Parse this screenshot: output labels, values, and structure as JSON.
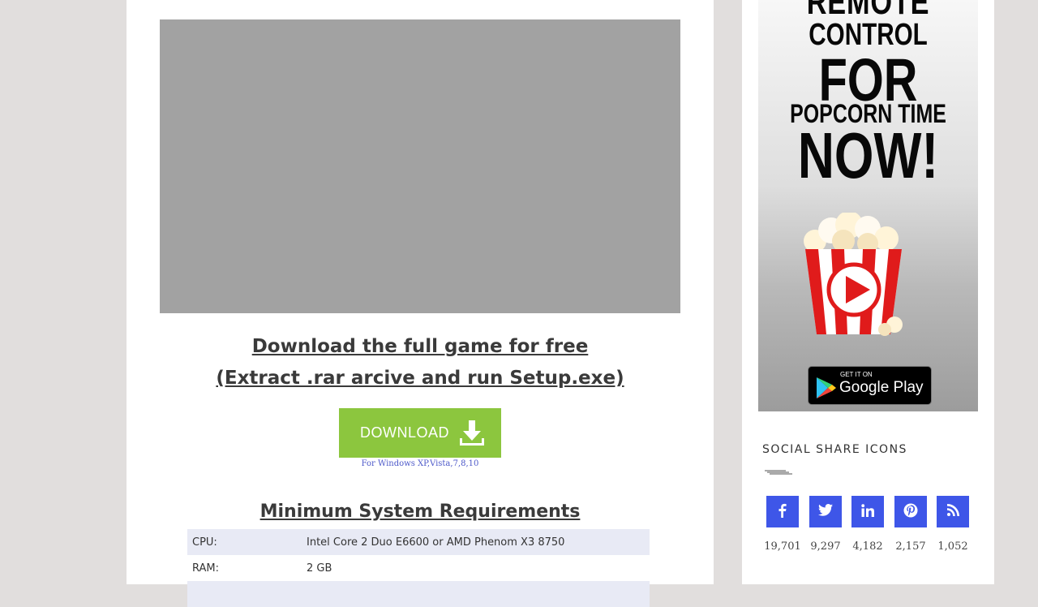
{
  "main": {
    "download_title_line1": "Download the full game for free",
    "download_title_line2": "(Extract .rar arcive and run Setup.exe)",
    "download_button_label": "DOWNLOAD",
    "download_note": "For Windows XP,Vista,7,8,10",
    "requirements_title": "Minimum System Requirements",
    "requirements": [
      {
        "label": "CPU:",
        "value": "Intel Core 2 Duo E6600 or AMD Phenom X3 8750"
      },
      {
        "label": "RAM:",
        "value": "2 GB"
      }
    ]
  },
  "sidebar": {
    "ad": {
      "line1": "REMOTE",
      "line2": "CONTROL",
      "line3": "FOR",
      "line4": "POPCORN TIME",
      "line5": "NOW!",
      "store_small": "GET IT ON",
      "store_big": "Google Play"
    },
    "share_title": "SOCIAL SHARE ICONS",
    "share_buttons": [
      {
        "icon": "facebook-icon",
        "count": "19,701"
      },
      {
        "icon": "twitter-icon",
        "count": "9,297"
      },
      {
        "icon": "linkedin-icon",
        "count": "4,182"
      },
      {
        "icon": "pinterest-icon",
        "count": "2,157"
      },
      {
        "icon": "rss-icon",
        "count": "1,052"
      }
    ]
  },
  "colors": {
    "accent_green": "#8cc63e",
    "share_blue": "#3e56e8",
    "note_blue": "#4d59c9"
  }
}
